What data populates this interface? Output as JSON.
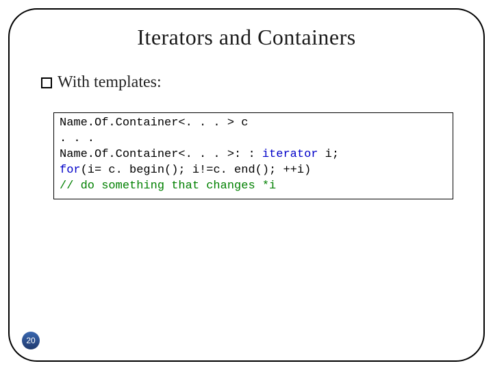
{
  "slide": {
    "title": "Iterators and Containers",
    "bullet": "With templates:",
    "page_number": "20"
  },
  "code": {
    "l1a": "Name.Of.Container<. . . > c",
    "l2": ". . .",
    "l3a": "Name.Of.Container<. . . >: : ",
    "l3b": "iterator",
    "l3c": " i;",
    "l4a": "for",
    "l4b": "(i= c. begin(); i!=c. end(); ++i)",
    "l5a": "// do something that changes *i"
  }
}
